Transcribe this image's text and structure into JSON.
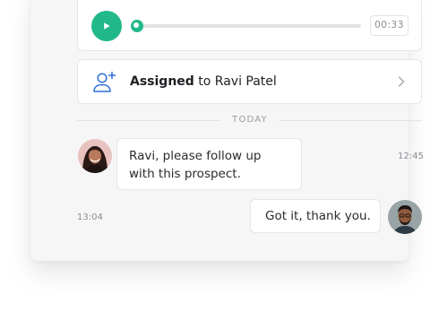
{
  "audio_player": {
    "duration": "00:33",
    "progress": 0,
    "accent_color": "#21b88a",
    "play_icon": "play-icon"
  },
  "assignment": {
    "action": "Assigned",
    "connector": "to",
    "assignee": "Ravi Patel",
    "icon": "assign-user-icon",
    "chevron": "chevron-right-icon"
  },
  "day_separator": "TODAY",
  "messages": [
    {
      "direction": "incoming",
      "text": "Ravi, please follow up with this prospect.",
      "time": "12:45",
      "avatar": "female-avatar"
    },
    {
      "direction": "outgoing",
      "text": "Got it, thank you.",
      "time": "13:04",
      "avatar": "male-avatar"
    }
  ]
}
